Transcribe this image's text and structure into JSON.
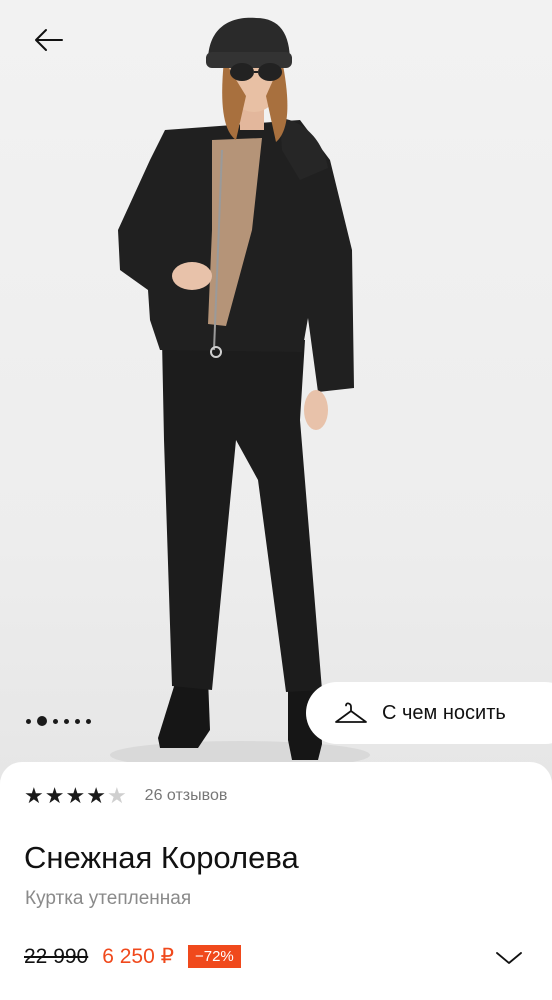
{
  "header": {
    "back_icon": "arrow-left-icon"
  },
  "gallery": {
    "total_images": 6,
    "active_index": 1
  },
  "wear_button": {
    "icon": "hanger-icon",
    "label": "С чем носить"
  },
  "product": {
    "rating": 4,
    "rating_max": 5,
    "reviews_label": "26 отзывов",
    "brand": "Снежная Королева",
    "subtitle": "Куртка утепленная",
    "old_price": "22 990",
    "new_price": "6 250 ₽",
    "discount": "−72%",
    "expand_icon": "chevron-down-icon"
  },
  "colors": {
    "accent": "#f0491c",
    "text": "#111111",
    "muted": "#8a8a8a"
  }
}
